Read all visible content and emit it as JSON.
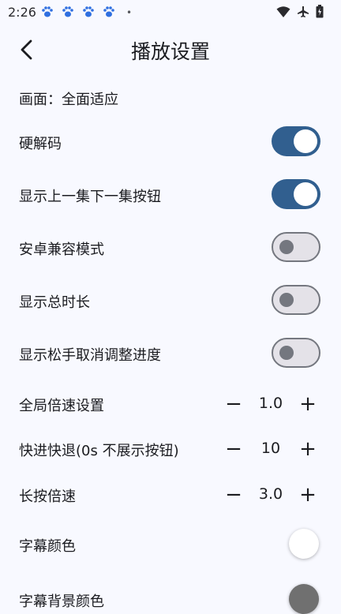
{
  "status": {
    "time": "2:26",
    "dot": "•",
    "icons": [
      "paw-icon",
      "paw-icon",
      "paw-icon",
      "paw-icon",
      "wifi-icon",
      "airplane-icon",
      "battery-icon"
    ]
  },
  "header": {
    "title": "播放设置"
  },
  "settings": {
    "picture": "画面：全面适应",
    "hw_decode": {
      "label": "硬解码",
      "on": true
    },
    "show_prev_next": {
      "label": "显示上一集下一集按钮",
      "on": true
    },
    "android_compat": {
      "label": "安卓兼容模式",
      "on": false
    },
    "show_total_time": {
      "label": "显示总时长",
      "on": false
    },
    "cancel_on_release": {
      "label": "显示松手取消调整进度",
      "on": false
    },
    "global_speed": {
      "label": "全局倍速设置",
      "minus": "−",
      "value": "1.0",
      "plus": "+"
    },
    "seek_step": {
      "label": "快进快退(0s 不展示按钮)",
      "minus": "−",
      "value": "10",
      "plus": "+"
    },
    "long_press_speed": {
      "label": "长按倍速",
      "minus": "−",
      "value": "3.0",
      "plus": "+"
    },
    "subtitle_color": {
      "label": "字幕颜色",
      "color": "#FFFFFF"
    },
    "subtitle_bg_color": {
      "label": "字幕背景颜色",
      "color": "#707070"
    }
  },
  "colors": {
    "accent": "#315F8F",
    "background": "#F8F9FF"
  }
}
